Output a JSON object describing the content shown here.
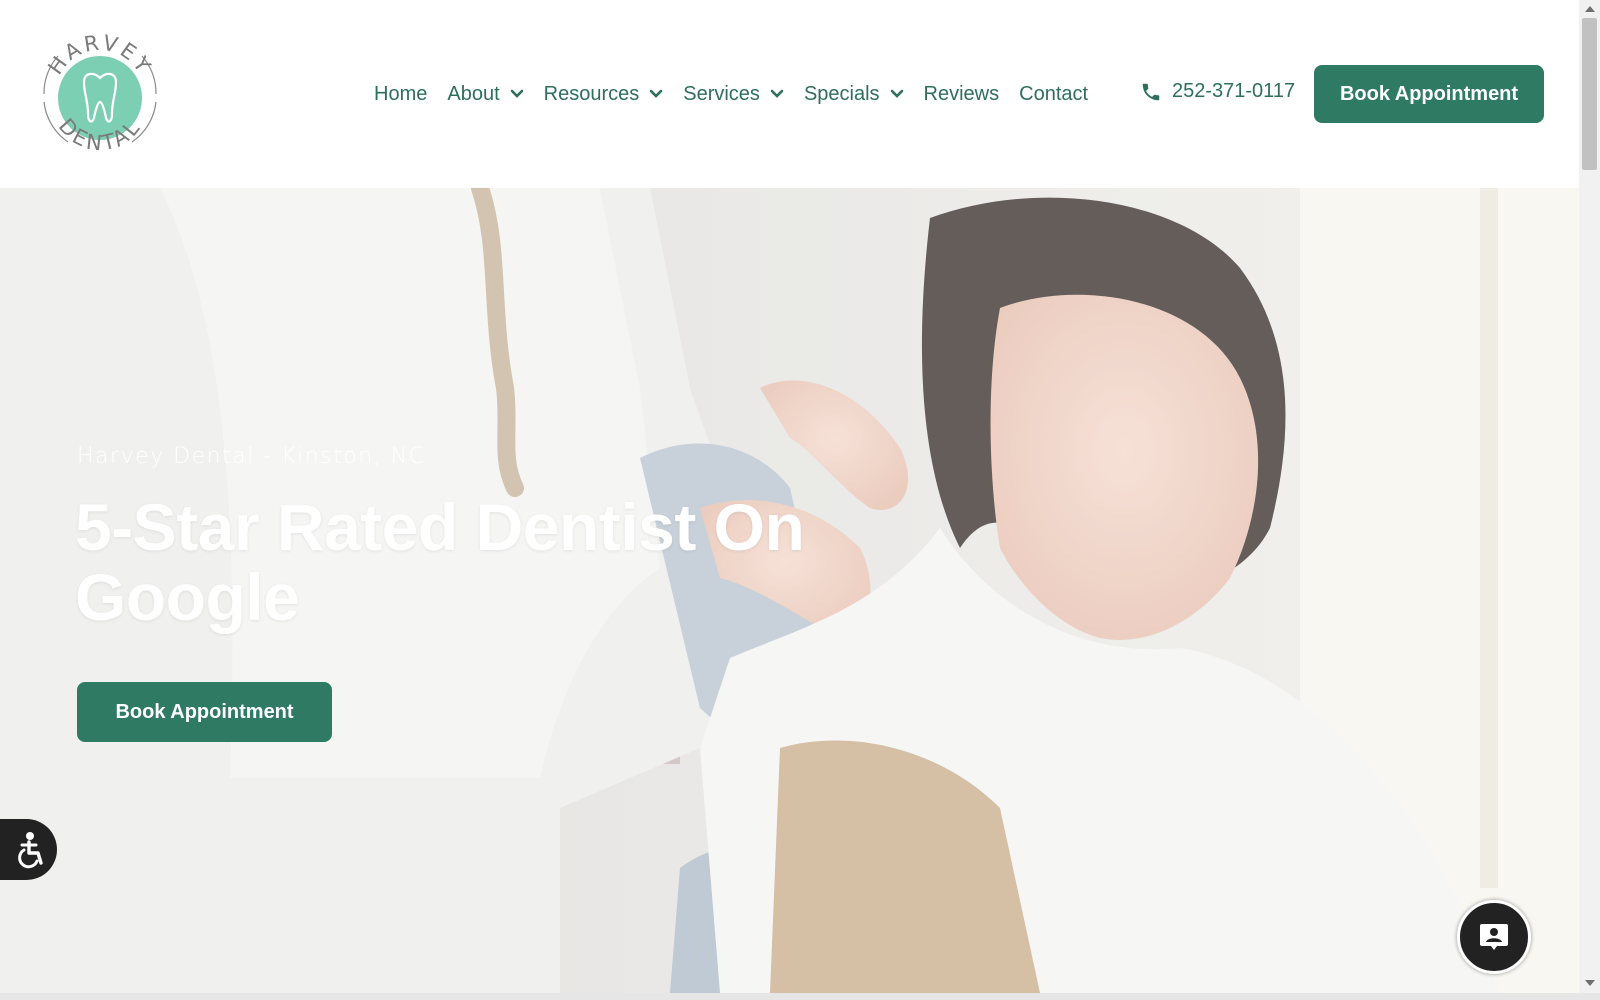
{
  "logo": {
    "top_text": "HARVEY",
    "bottom_text": "DENTAL",
    "accent": "#7ccfb2"
  },
  "nav": {
    "items": [
      {
        "label": "Home",
        "dropdown": false
      },
      {
        "label": "About",
        "dropdown": true
      },
      {
        "label": "Resources",
        "dropdown": true
      },
      {
        "label": "Services",
        "dropdown": true
      },
      {
        "label": "Specials",
        "dropdown": true
      },
      {
        "label": "Reviews",
        "dropdown": false
      },
      {
        "label": "Contact",
        "dropdown": false
      }
    ]
  },
  "phone": {
    "number": "252-371-0117",
    "icon": "phone-icon"
  },
  "header_cta": {
    "label": "Book Appointment"
  },
  "hero": {
    "subtitle": "Harvey Dental - Kinston, NC",
    "title": "5-Star Rated Dentist On Google",
    "cta_label": "Book Appointment"
  },
  "widgets": {
    "accessibility_icon": "accessibility-icon",
    "chat_icon": "chat-icon"
  },
  "colors": {
    "brand_green": "#2f7a62",
    "nav_text": "#2e6e5c",
    "logo_mint": "#7ccfb2"
  }
}
